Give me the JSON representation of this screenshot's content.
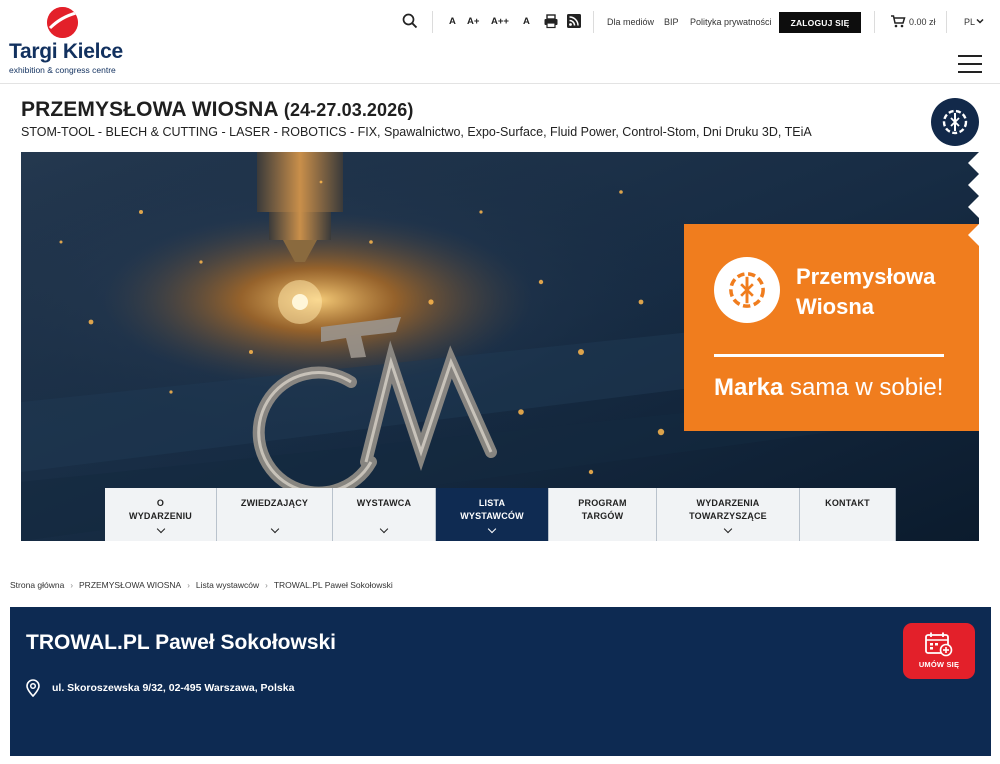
{
  "brand": {
    "name": "Targi Kielce",
    "tagline": "exhibition & congress centre",
    "red": "#e3202a",
    "navy": "#12315f"
  },
  "topbar": {
    "font_sizes": [
      "A",
      "A+",
      "A++",
      "A"
    ],
    "links": [
      "Dla mediów",
      "BIP",
      "Polityka prywatności"
    ],
    "login_label": "ZALOGUJ SIĘ",
    "cart_total": "0.00 zł",
    "language": "PL",
    "icons": [
      "search-icon",
      "print-icon",
      "rss-icon",
      "cart-icon",
      "chevron-down-icon",
      "menu-icon"
    ]
  },
  "event": {
    "title": "PRZEMYSŁOWA WIOSNA",
    "dates": "(24-27.03.2026)",
    "subtitle": "STOM-TOOL - BLECH & CUTTING - LASER - ROBOTICS - FIX, Spawalnictwo, Expo-Surface, Fluid Power, Control-Stom, Dni Druku 3D, TEiA"
  },
  "hero": {
    "promo_name_line1": "Przemysłowa",
    "promo_name_line2": "Wiosna",
    "tagline_bold": "Marka",
    "tagline_rest": " sama w sobie!",
    "orange": "#f07d1e"
  },
  "nav": {
    "items": [
      {
        "line1": "O",
        "line2": "WYDARZENIU",
        "has_dropdown": true,
        "active": false
      },
      {
        "line1": "ZWIEDZAJĄCY",
        "line2": "",
        "has_dropdown": true,
        "active": false
      },
      {
        "line1": "WYSTAWCA",
        "line2": "",
        "has_dropdown": true,
        "active": false
      },
      {
        "line1": "LISTA",
        "line2": "WYSTAWCÓW",
        "has_dropdown": true,
        "active": true
      },
      {
        "line1": "PROGRAM",
        "line2": "TARGÓW",
        "has_dropdown": false,
        "active": false
      },
      {
        "line1": "WYDARZENIA",
        "line2": "TOWARZYSZĄCE",
        "has_dropdown": true,
        "active": false
      },
      {
        "line1": "KONTAKT",
        "line2": "",
        "has_dropdown": false,
        "active": false
      }
    ]
  },
  "breadcrumb": {
    "items": [
      "Strona główna",
      "PRZEMYSŁOWA WIOSNA",
      "Lista wystawców",
      "TROWAL.PL Paweł Sokołowski"
    ],
    "separator": "›"
  },
  "exhibitor": {
    "name": "TROWAL.PL Paweł Sokołowski",
    "address": "ul. Skoroszewska 9/32, 02-495 Warszawa, Polska",
    "meet_label": "UMÓW SIĘ",
    "bg": "#0d2a52"
  }
}
